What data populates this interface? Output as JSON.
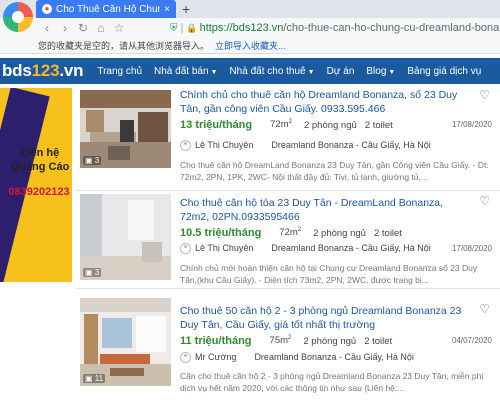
{
  "browser": {
    "tab_title": "Cho Thuê Căn Hộ Chung Cư",
    "tab_close": "×",
    "new_tab": "+",
    "url_host": "https://bds123.vn",
    "url_path": "/cho-thue-can-ho-chung-cu-dreamland-bonanza-quan",
    "bookmarks_text": "您的收藏夹是空的，请从其他浏览器导入。",
    "bookmarks_link": "立即导入收藏夹..."
  },
  "site": {
    "logo_prefix": "bds",
    "logo_number": "123",
    "logo_suffix": ".vn",
    "nav": [
      "Trang chủ",
      "Nhà đất bán",
      "Nhà đất cho thuê",
      "Dự án",
      "Blog",
      "Bảng giá dịch vụ"
    ]
  },
  "ad": {
    "line1": "Liên hệ",
    "line2": "Quảng Cáo",
    "phone": "0839202123"
  },
  "listings": [
    {
      "title": "Chính chủ cho thuê căn hộ Dreamland Bonanza, số 23 Duy Tân, gần công viên Cầu Giấy. 0933.595.466",
      "price": "13 triệu/tháng",
      "area": "72m",
      "area_unit": "2",
      "beds": "2 phòng ngủ",
      "toilets": "2 toilet",
      "date": "17/08/2020",
      "agent": "Lê Thị Chuyên",
      "location": "Dreamland Bonanza - Cầu Giấy, Hà Nội",
      "desc": "Cho thuê căn hộ DreamLand Bonanza 23 Duy Tân, gần Công viên Cầu Giấy. - Dt: 72m2, 2PN, 1PK, 2WC- Nội thất đầy đủ: Tivi, tủ lạnh, giường tủ,...",
      "photos": "3"
    },
    {
      "title": "Cho thuê căn hộ tòa 23 Duy Tân - DreamLand Bonanza, 72m2, 02PN.0933595466",
      "price": "10.5 triệu/tháng",
      "area": "72m",
      "area_unit": "2",
      "beds": "2 phòng ngủ",
      "toilets": "2 toilet",
      "date": "17/08/2020",
      "agent": "Lê Thị Chuyên",
      "location": "Dreamland Bonanza - Cầu Giấy, Hà Nội",
      "desc": "Chính chủ mới hoàn thiện căn hộ tại Chung cư Dreamland Bonanza số 23 Duy Tân,(khu Cầu Giấy). - Diện tích 73m2, 2PN, 2WC, được trang bị...",
      "photos": "3"
    },
    {
      "title": "Cho thuê 50 căn hộ 2 - 3 phòng ngủ Dreamland Bonanza 23 Duy Tân, Cầu Giấy, giá tốt nhất thị trường",
      "price": "11 triệu/tháng",
      "area": "75m",
      "area_unit": "2",
      "beds": "2 phòng ngủ",
      "toilets": "2 toilet",
      "date": "04/07/2020",
      "agent": "Mr Cường",
      "location": "Dreamland Bonanza - Cầu Giấy, Hà Nội",
      "desc": "Căn cho thuê căn hộ 2 - 3 phòng ngủ Dreamland Bonanza 23 Duy Tân, miễn phí dịch vụ hết năm 2020, với các thông tin như sau (Liên hệ:...",
      "photos": "11"
    }
  ],
  "colors": {
    "nav_bg": "#1b5a9e",
    "title_link": "#1c57a5",
    "price": "#2e8b2e",
    "ad_bg": "#f5c11a",
    "ad_phone": "#d0163b"
  }
}
